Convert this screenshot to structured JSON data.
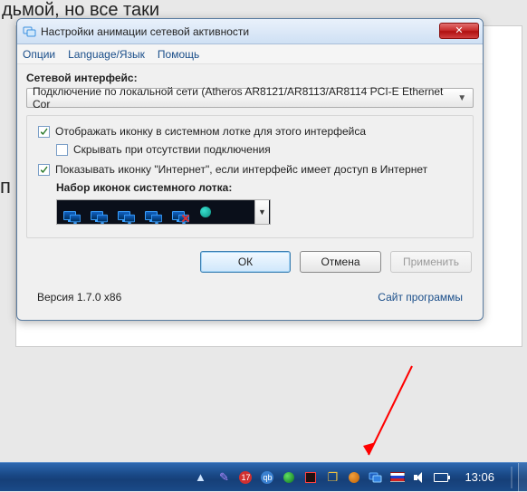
{
  "background_text_top": "дьмой, но все таки",
  "background_text_mid": "п",
  "window": {
    "title": "Настройки анимации сетевой активности",
    "menu": {
      "options": "Опции",
      "language": "Language/Язык",
      "help": "Помощь"
    },
    "close_x": "✕"
  },
  "section_label": "Сетевой интерфейс:",
  "dropdown_value": "Подключение по локальной сети (Atheros AR8121/AR8113/AR8114 PCI-E Ethernet Cor",
  "checks": {
    "show_tray": {
      "checked": true,
      "label": "Отображать иконку в системном лотке для этого интерфейса"
    },
    "hide_noconn": {
      "checked": false,
      "label": "Скрывать при отсутствии подключения"
    },
    "show_internet": {
      "checked": true,
      "label": "Показывать иконку \"Интернет\", если интерфейс имеет доступ в Интернет"
    }
  },
  "iconset_label": "Набор иконок системного лотка:",
  "buttons": {
    "ok": "ОК",
    "cancel": "Отмена",
    "apply": "Применить"
  },
  "footer": {
    "version": "Версия 1.7.0 x86",
    "site_link": "Сайт программы"
  },
  "taskbar": {
    "clock": "13:06"
  }
}
